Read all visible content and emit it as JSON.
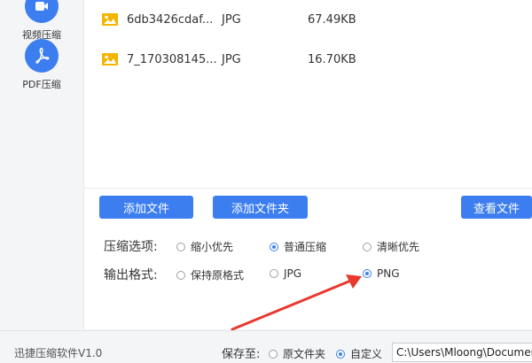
{
  "sidebar": {
    "items": [
      {
        "label": "视频压缩",
        "icon": "video-icon"
      },
      {
        "label": "PDF压缩",
        "icon": "pdf-icon"
      }
    ]
  },
  "files": [
    {
      "name": "6db3426cdaf...",
      "type": "JPG",
      "size": "67.49KB"
    },
    {
      "name": "7_170308145...",
      "type": "JPG",
      "size": "16.70KB"
    }
  ],
  "toolbar": {
    "add_file": "添加文件",
    "add_folder": "添加文件夹",
    "view_file": "查看文件"
  },
  "compress": {
    "label": "压缩选项:",
    "options": [
      "缩小优先",
      "普通压缩",
      "清晰优先"
    ],
    "selected": 1
  },
  "format": {
    "label": "输出格式:",
    "options": [
      "保持原格式",
      "JPG",
      "PNG"
    ],
    "selected": 2
  },
  "status": {
    "app_version": "迅捷压缩软件V1.0",
    "save_to_label": "保存至:",
    "save_options": [
      "原文件夹",
      "自定义"
    ],
    "save_selected": 1,
    "path_value": "C:\\Users\\Mloong\\Documents"
  },
  "colors": {
    "accent": "#3c7ef0",
    "arrow": "#e8392f"
  }
}
